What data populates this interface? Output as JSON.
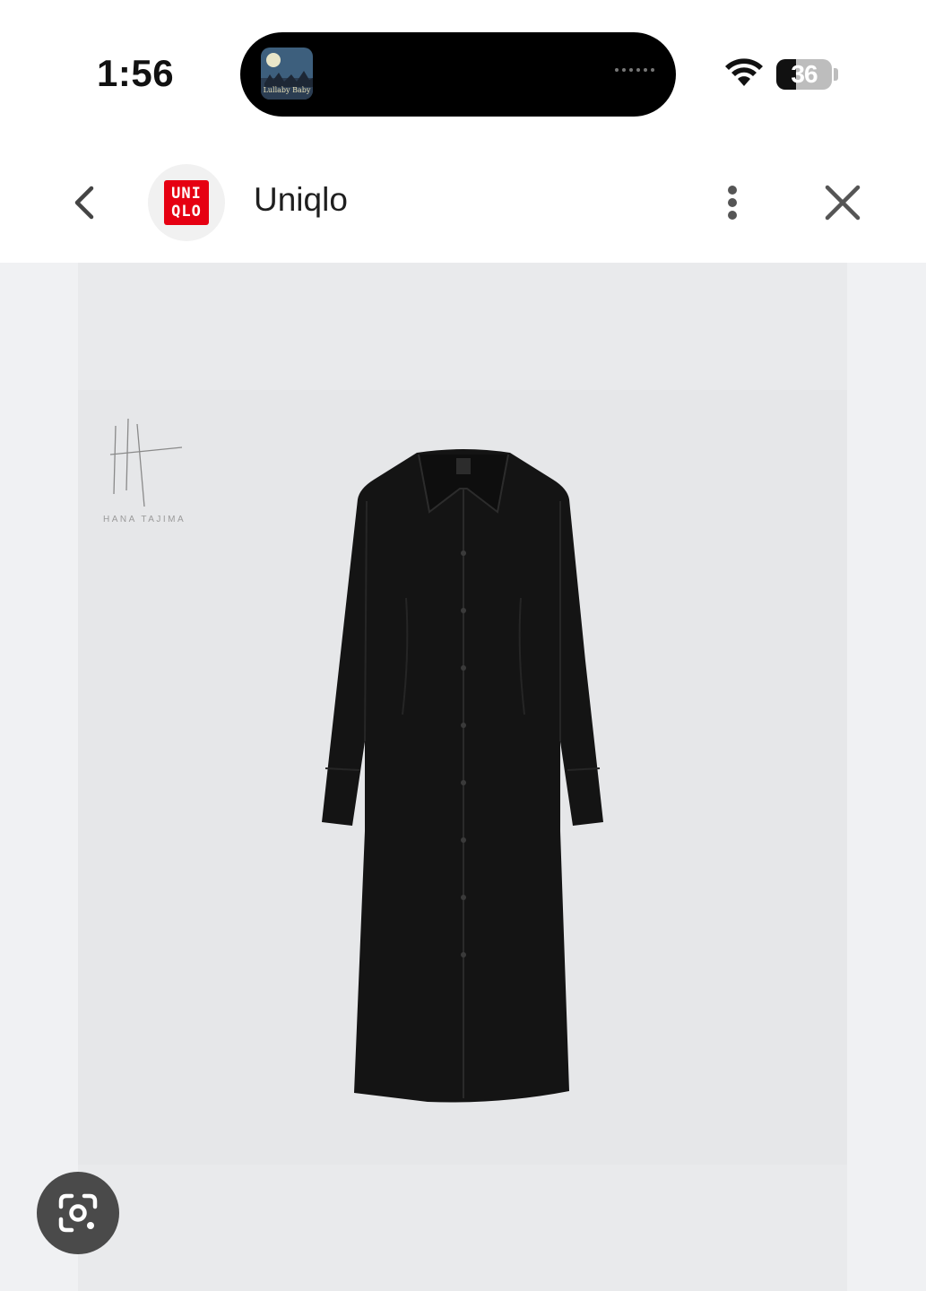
{
  "status_bar": {
    "time": "1:56",
    "battery_level": "36",
    "island_media_title": "Lullaby Baby"
  },
  "header": {
    "site_name": "Uniqlo",
    "logo_line1": "UNI",
    "logo_line2": "QLO",
    "logo_color": "#e60012"
  },
  "product_image": {
    "brand_caption": "HANA TAJIMA"
  },
  "icons": {
    "back": "chevron-left-icon",
    "more": "more-vertical-icon",
    "close": "close-icon",
    "lens": "lens-icon",
    "wifi": "wifi-icon"
  }
}
